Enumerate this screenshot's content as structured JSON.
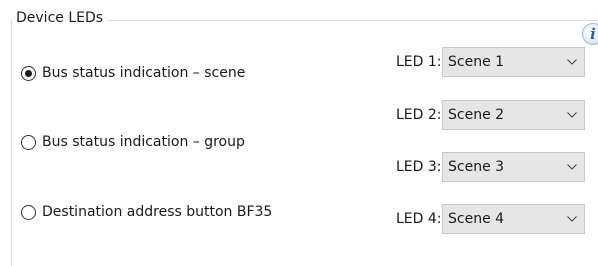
{
  "groupbox": {
    "title": "Device LEDs",
    "info_glyph": "i"
  },
  "radios": [
    {
      "label": "Bus status indication – scene",
      "checked": true
    },
    {
      "label": "Bus status indication – group",
      "checked": false
    },
    {
      "label": "Destination address button BF35",
      "checked": false
    }
  ],
  "leds": [
    {
      "label": "LED 1:",
      "value": "Scene 1"
    },
    {
      "label": "LED 2:",
      "value": "Scene 2"
    },
    {
      "label": "LED 3:",
      "value": "Scene 3"
    },
    {
      "label": "LED 4:",
      "value": "Scene 4"
    }
  ],
  "icons": {
    "info": "info-icon",
    "radio_selected": "radio-checked-icon",
    "radio_unselected": "radio-unchecked-icon",
    "dropdown": "chevron-down-icon"
  },
  "colors": {
    "combo_background": "#e6e6e6",
    "info_icon_glyph": "#2b5fa8"
  }
}
